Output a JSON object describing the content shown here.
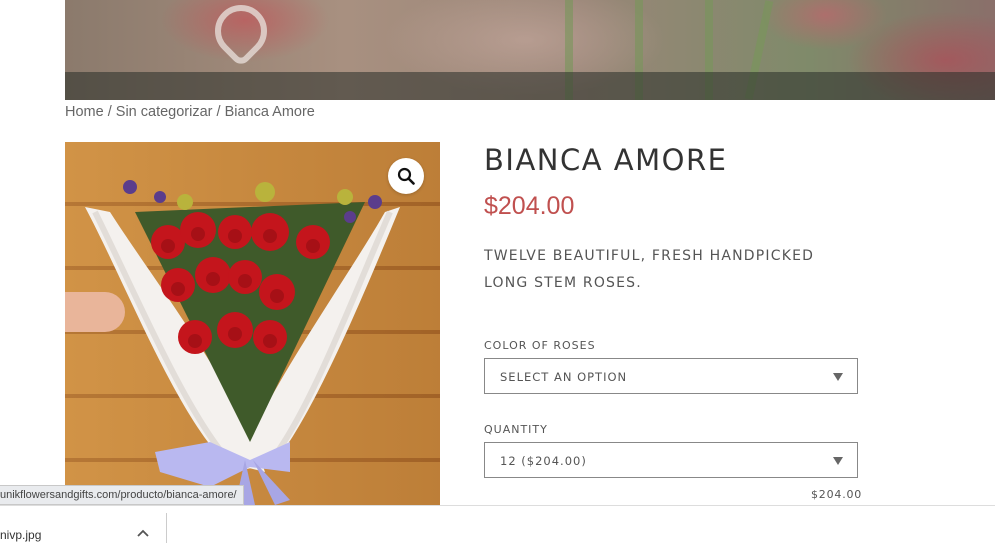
{
  "breadcrumb": {
    "home": "Home",
    "sep1": " / ",
    "category": "Sin categorizar",
    "sep2": " / ",
    "current": "Bianca Amore"
  },
  "product": {
    "title": "Bianca Amore",
    "price": "$204.00",
    "description": "Twelve beautiful, fresh handpicked long stem roses.",
    "zoom_icon": "magnifier-icon"
  },
  "options": {
    "color": {
      "label": "Color of roses",
      "value": "Select an option"
    },
    "quantity": {
      "label": "Quantity",
      "value": "12 ($204.00)"
    },
    "subtotal": "$204.00"
  },
  "browser": {
    "status_url": "unikflowersandgifts.com/producto/bianca-amore/",
    "download_file": "nivp.jpg",
    "download_chevron_icon": "chevron-up-icon"
  },
  "colors": {
    "price": "#c0504f",
    "text": "#333333"
  }
}
